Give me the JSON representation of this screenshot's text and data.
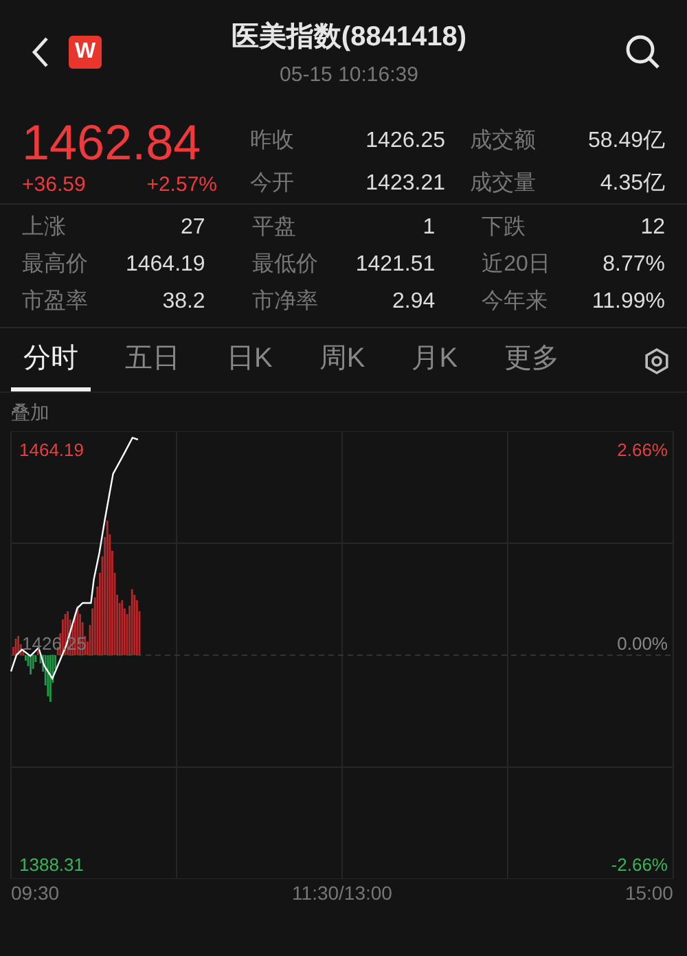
{
  "header": {
    "badge": "W",
    "title": "医美指数(8841418)",
    "time": "05-15 10:16:39"
  },
  "quote": {
    "price": "1462.84",
    "change": "+36.59",
    "change_pct": "+2.57%",
    "fields": [
      {
        "label": "昨收",
        "value": "1426.25"
      },
      {
        "label": "成交额",
        "value": "58.49亿"
      },
      {
        "label": "今开",
        "value": "1423.21"
      },
      {
        "label": "成交量",
        "value": "4.35亿"
      }
    ]
  },
  "stats": [
    {
      "label": "上涨",
      "value": "27"
    },
    {
      "label": "平盘",
      "value": "1"
    },
    {
      "label": "下跌",
      "value": "12"
    },
    {
      "label": "最高价",
      "value": "1464.19"
    },
    {
      "label": "最低价",
      "value": "1421.51"
    },
    {
      "label": "近20日",
      "value": "8.77%"
    },
    {
      "label": "市盈率",
      "value": "38.2"
    },
    {
      "label": "市净率",
      "value": "2.94"
    },
    {
      "label": "今年来",
      "value": "11.99%"
    }
  ],
  "tabs": [
    {
      "label": "分时",
      "selected": true
    },
    {
      "label": "五日",
      "selected": false
    },
    {
      "label": "日K",
      "selected": false
    },
    {
      "label": "周K",
      "selected": false
    },
    {
      "label": "月K",
      "selected": false
    },
    {
      "label": "更多",
      "selected": false
    }
  ],
  "overlay_label": "叠加",
  "chart": {
    "high_label": "1464.19",
    "high_pct": "2.66%",
    "prev_close_label": "1426.25",
    "zero_pct": "0.00%",
    "low_label": "1388.31",
    "low_pct": "-2.66%",
    "time_labels": [
      "09:30",
      "11:30/13:00",
      "15:00"
    ]
  }
}
